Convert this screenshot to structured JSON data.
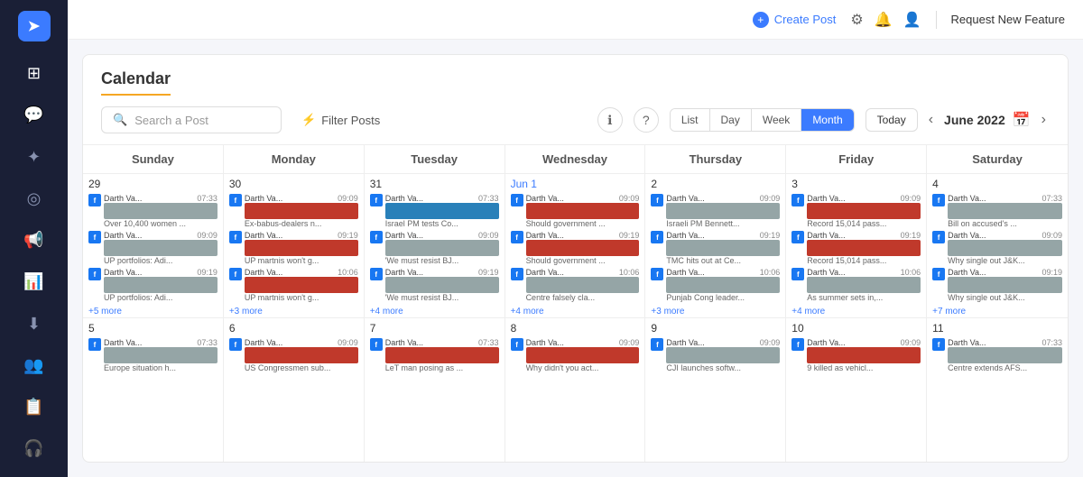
{
  "sidebar": {
    "logo": "➤",
    "icons": [
      "⊞",
      "💬",
      "✦",
      "◎",
      "📢",
      "📊",
      "⬇",
      "👥",
      "📋",
      "🎧"
    ]
  },
  "topnav": {
    "create_post": "Create Post",
    "request_feature": "Request New Feature",
    "icons": [
      "⚙",
      "🔔",
      "👤"
    ]
  },
  "calendar": {
    "title": "Calendar",
    "search_placeholder": "Search a Post",
    "filter_label": "Filter Posts",
    "view_buttons": [
      "List",
      "Day",
      "Week",
      "Month"
    ],
    "active_view": "Month",
    "today_label": "Today",
    "current_month": "June 2022",
    "day_headers": [
      "Sunday",
      "Monday",
      "Tuesday",
      "Wednesday",
      "Thursday",
      "Friday",
      "Saturday"
    ],
    "week1": {
      "days": [
        {
          "date": "29",
          "posts": [
            {
              "user": "Darth Va...",
              "time": "07:33",
              "desc": "Over 10,400 women ...",
              "color": "gray"
            },
            {
              "user": "Darth Va...",
              "time": "09:09",
              "desc": "UP portfolios: Adi...",
              "color": "red"
            },
            {
              "user": "Darth Va...",
              "time": "09:19",
              "desc": "UP portfolios: Adi...",
              "color": "gray"
            }
          ],
          "more": "+5 more"
        },
        {
          "date": "30",
          "posts": [
            {
              "user": "Darth Va...",
              "time": "09:09",
              "desc": "Ex-babus-dealers n...",
              "color": "red"
            },
            {
              "user": "Darth Va...",
              "time": "09:19",
              "desc": "UP martnis won't g...",
              "color": "red"
            },
            {
              "user": "Darth Va...",
              "time": "10:06",
              "desc": "UP martnis won't g...",
              "color": "red"
            }
          ],
          "more": "+3 more"
        },
        {
          "date": "31",
          "posts": [
            {
              "user": "Darth Va...",
              "time": "07:33",
              "desc": "Israel PM tests Co...",
              "color": "blue"
            },
            {
              "user": "Darth Va...",
              "time": "09:09",
              "desc": "'We must resist BJ...",
              "color": "gray"
            },
            {
              "user": "Darth Va...",
              "time": "09:19",
              "desc": "'We must resist BJ...",
              "color": "gray"
            }
          ],
          "more": "+4 more"
        },
        {
          "date": "Jun 1",
          "posts": [
            {
              "user": "Darth Va...",
              "time": "09:09",
              "desc": "Should government ...",
              "color": "red"
            },
            {
              "user": "Darth Va...",
              "time": "09:19",
              "desc": "Should government ...",
              "color": "red"
            },
            {
              "user": "Darth Va...",
              "time": "10:06",
              "desc": "Centre falsely cla...",
              "color": "gray"
            }
          ],
          "more": "+4 more"
        },
        {
          "date": "2",
          "posts": [
            {
              "user": "Darth Va...",
              "time": "09:09",
              "desc": "Israeli PM Bennett...",
              "color": "gray"
            },
            {
              "user": "Darth Va...",
              "time": "09:19",
              "desc": "TMC hits out at Ce...",
              "color": "gray"
            },
            {
              "user": "Darth Va...",
              "time": "10:06",
              "desc": "Punjab Cong leader...",
              "color": "gray"
            }
          ],
          "more": "+3 more"
        },
        {
          "date": "3",
          "posts": [
            {
              "user": "Darth Va...",
              "time": "09:09",
              "desc": "Record 15,014 pass...",
              "color": "red"
            },
            {
              "user": "Darth Va...",
              "time": "09:19",
              "desc": "Record 15,014 pass...",
              "color": "red"
            },
            {
              "user": "Darth Va...",
              "time": "10:06",
              "desc": "As summer sets in,...",
              "color": "gray"
            }
          ],
          "more": "+4 more"
        },
        {
          "date": "4",
          "posts": [
            {
              "user": "Darth Va...",
              "time": "07:33",
              "desc": "Bill on accused's ...",
              "color": "gray"
            },
            {
              "user": "Darth Va...",
              "time": "09:09",
              "desc": "Why single out J&K...",
              "color": "gray"
            },
            {
              "user": "Darth Va...",
              "time": "09:19",
              "desc": "Why single out J&K...",
              "color": "gray"
            }
          ],
          "more": "+7 more"
        }
      ]
    },
    "week2": {
      "days": [
        {
          "date": "5",
          "posts": [
            {
              "user": "Darth Va...",
              "time": "07:33",
              "desc": "Europe situation h...",
              "color": "gray"
            }
          ],
          "more": null
        },
        {
          "date": "6",
          "posts": [
            {
              "user": "Darth Va...",
              "time": "09:09",
              "desc": "US Congressmen sub...",
              "color": "red"
            }
          ],
          "more": null
        },
        {
          "date": "7",
          "posts": [
            {
              "user": "Darth Va...",
              "time": "07:33",
              "desc": "LeT man posing as ...",
              "color": "red"
            }
          ],
          "more": null
        },
        {
          "date": "8",
          "posts": [
            {
              "user": "Darth Va...",
              "time": "09:09",
              "desc": "Why didn't you act...",
              "color": "red"
            }
          ],
          "more": null
        },
        {
          "date": "9",
          "posts": [
            {
              "user": "Darth Va...",
              "time": "09:09",
              "desc": "CJI launches softw...",
              "color": "gray"
            }
          ],
          "more": null
        },
        {
          "date": "10",
          "posts": [
            {
              "user": "Darth Va...",
              "time": "09:09",
              "desc": "9 killed as vehicl...",
              "color": "red"
            }
          ],
          "more": null
        },
        {
          "date": "11",
          "posts": [
            {
              "user": "Darth Va...",
              "time": "07:33",
              "desc": "Centre extends AFS...",
              "color": "gray"
            }
          ],
          "more": null
        }
      ]
    }
  }
}
